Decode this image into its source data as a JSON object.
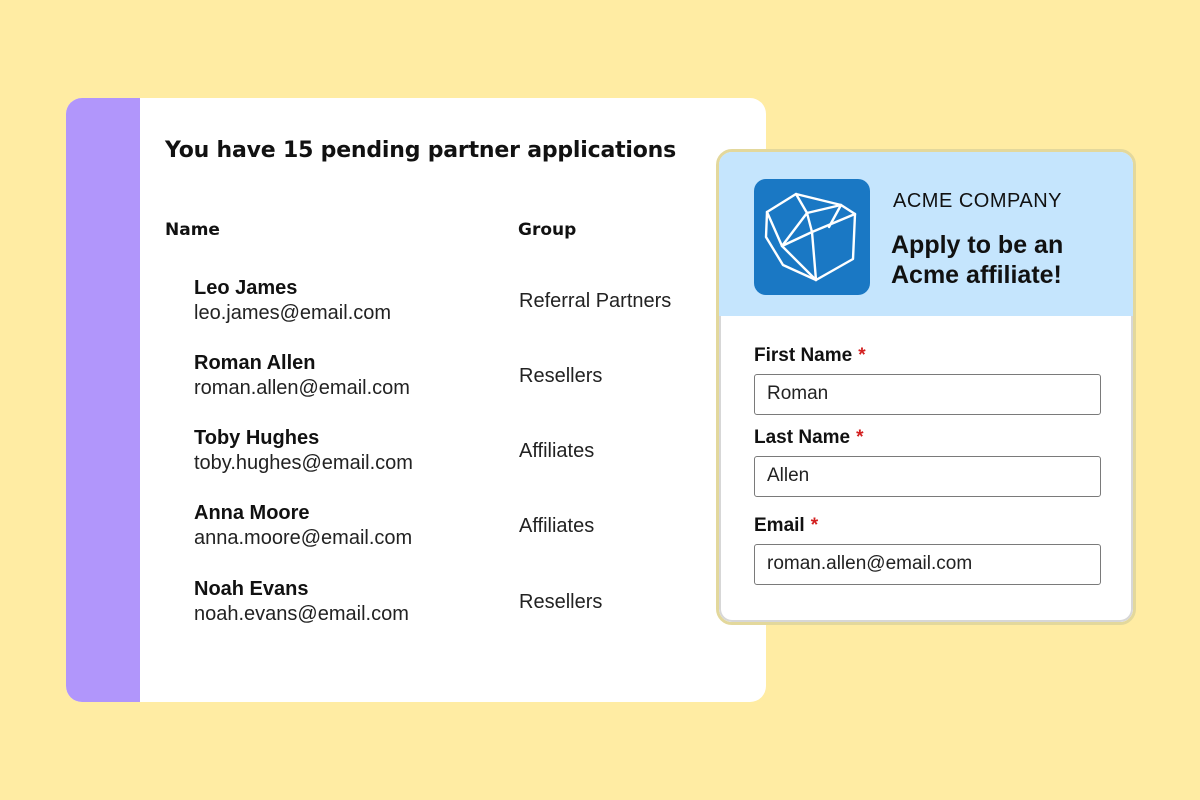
{
  "applications": {
    "title": "You have 15 pending partner applications",
    "columns": {
      "name": "Name",
      "group": "Group"
    },
    "rows": [
      {
        "name": "Leo James",
        "email": "leo.james@email.com",
        "group": "Referral Partners"
      },
      {
        "name": "Roman Allen",
        "email": "roman.allen@email.com",
        "group": "Resellers"
      },
      {
        "name": "Toby Hughes",
        "email": "toby.hughes@email.com",
        "group": "Affiliates"
      },
      {
        "name": "Anna Moore",
        "email": "anna.moore@email.com",
        "group": "Affiliates"
      },
      {
        "name": "Noah Evans",
        "email": "noah.evans@email.com",
        "group": "Resellers"
      }
    ]
  },
  "form": {
    "logo_icon": "polyhedron-logo-icon",
    "company": "ACME COMPANY",
    "headline": "Apply to be an Acme affiliate!",
    "required_marker": "*",
    "fields": {
      "first_name": {
        "label": "First Name",
        "value": "Roman"
      },
      "last_name": {
        "label": "Last Name",
        "value": "Allen"
      },
      "email": {
        "label": "Email",
        "value": "roman.allen@email.com"
      }
    }
  },
  "colors": {
    "background": "#ffeca3",
    "accent_bar": "#b196fb",
    "form_header": "#c5e5fd",
    "logo_bg": "#1a78c4",
    "required": "#d32020"
  }
}
